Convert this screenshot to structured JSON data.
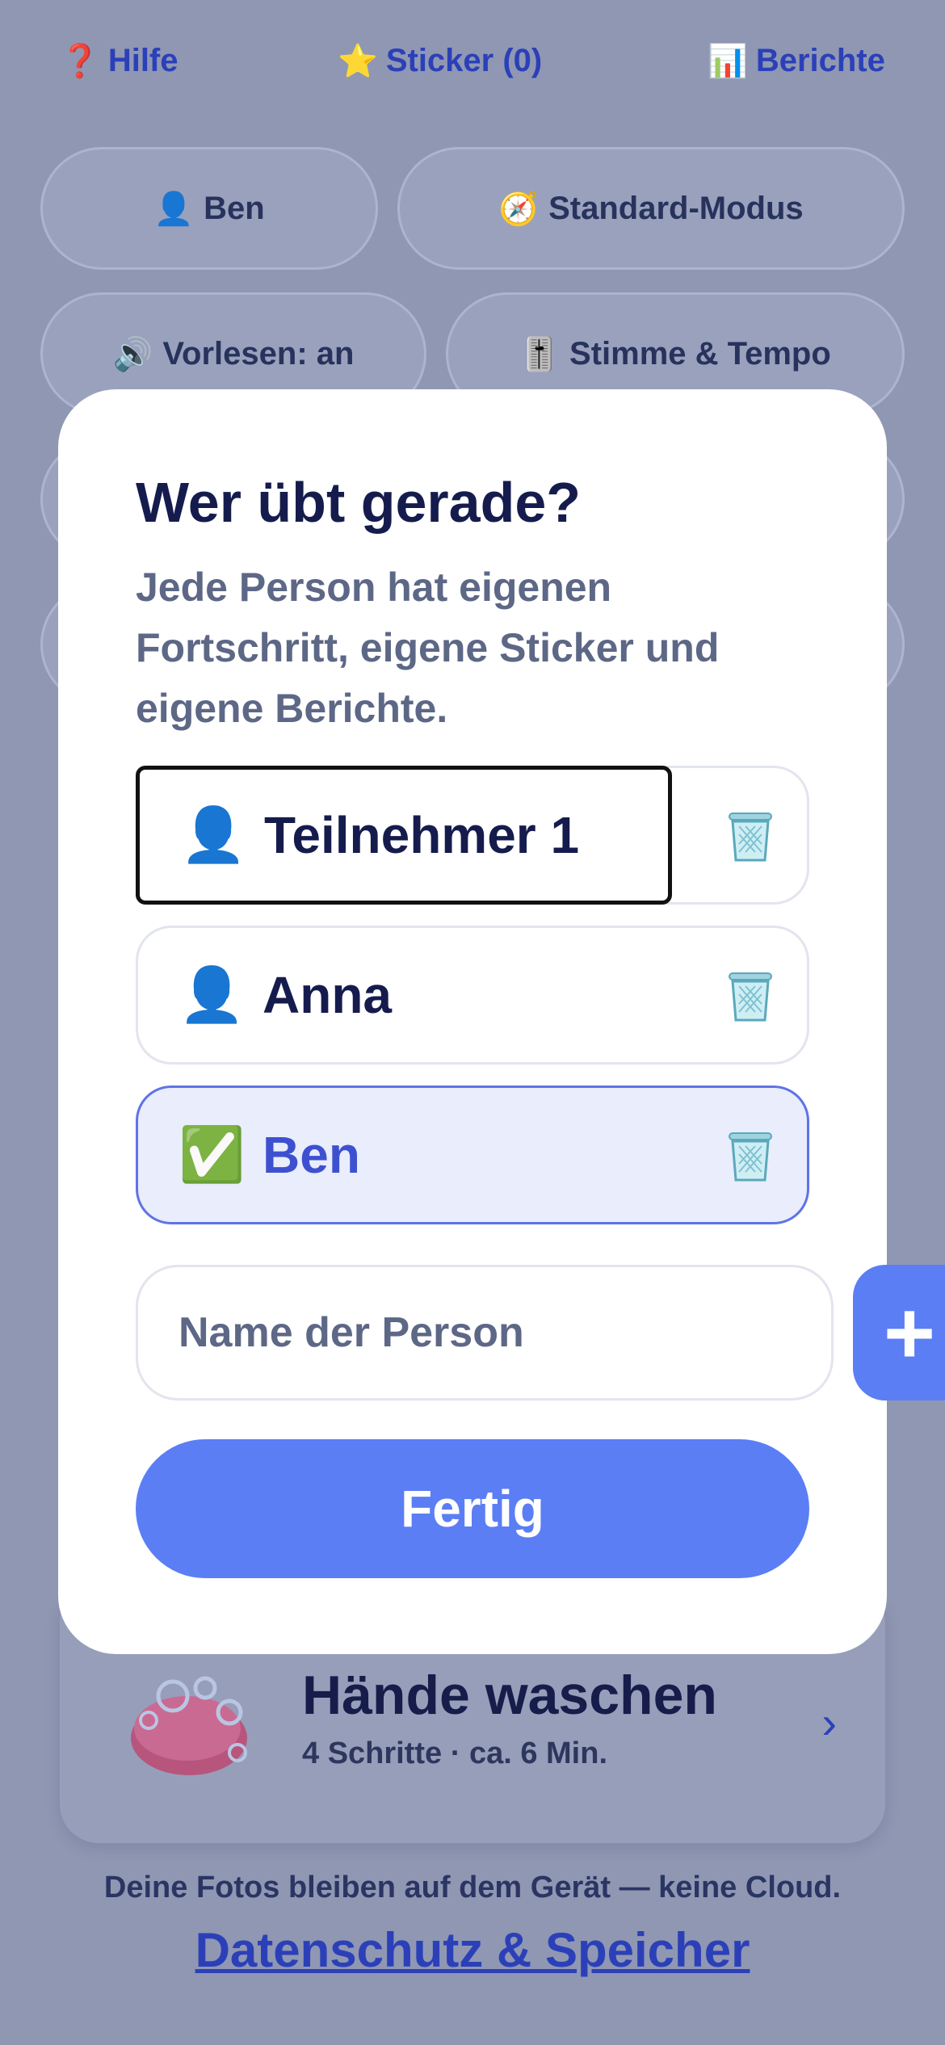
{
  "topbar": {
    "help": {
      "icon": "question-icon",
      "glyph": "❓",
      "label": "Hilfe"
    },
    "stickers": {
      "icon": "star-icon",
      "glyph": "⭐",
      "label": "Sticker (0)"
    },
    "reports": {
      "icon": "bar-chart-icon",
      "glyph": "📊",
      "label": "Berichte"
    }
  },
  "controls": {
    "profile": {
      "icon": "person-icon",
      "glyph": "👤",
      "label": "Ben"
    },
    "mode": {
      "icon": "compass-icon",
      "glyph": "🧭",
      "label": "Standard-Modus"
    },
    "read_aloud": {
      "icon": "speaker-icon",
      "glyph": "🔊",
      "label": "Vorlesen: an"
    },
    "voice": {
      "icon": "slider-icon",
      "glyph": "🎚️",
      "label": "Stimme & Tempo"
    }
  },
  "activity_card": {
    "title": "Hände waschen",
    "subtitle": "4 Schritte · ca. 6 Min.",
    "chevron": "›"
  },
  "footer": {
    "note": "Deine Fotos bleiben auf dem Gerät — keine Cloud.",
    "link": "Datenschutz & Speicher"
  },
  "modal": {
    "title": "Wer übt gerade?",
    "description": "Jede Person hat eigenen Fortschritt, eigene Sticker und eigene Berichte.",
    "people": [
      {
        "name": "Teilnehmer 1",
        "glyph": "👤",
        "icon": "person-icon",
        "selected": false
      },
      {
        "name": "Anna",
        "glyph": "👤",
        "icon": "person-icon",
        "selected": false
      },
      {
        "name": "Ben",
        "glyph": "✅",
        "icon": "check-icon",
        "selected": true
      }
    ],
    "name_placeholder": "Name der Person",
    "add_label": "+",
    "done_label": "Fertig"
  },
  "colors": {
    "accent": "#5b7ef5",
    "selected_bg": "#e9edfc",
    "overlay": "#8f97b3",
    "title_text": "#151c4d",
    "link": "#2b40b8"
  }
}
